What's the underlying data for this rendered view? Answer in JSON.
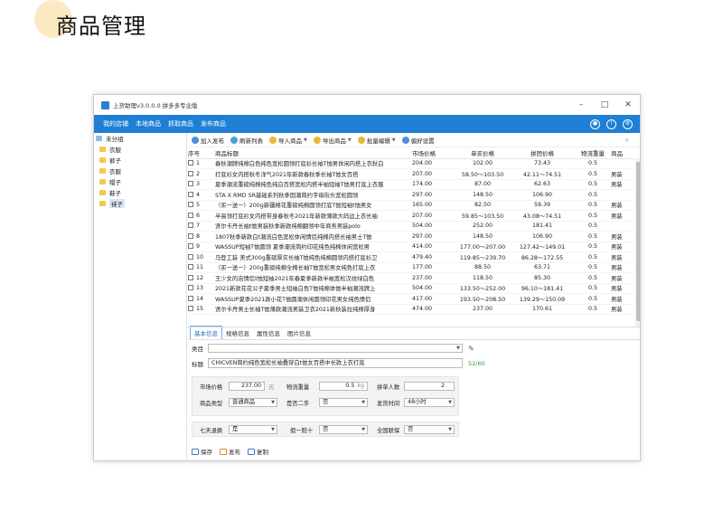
{
  "heading": "商品管理",
  "window": {
    "title": "上货助理v3.0.0.0 拼多多专业版",
    "min": "–",
    "max": "□",
    "close": "✕"
  },
  "menu": [
    "我的店铺",
    "本地商品",
    "抓取商品",
    "发布商品"
  ],
  "sidebar": [
    "未分组",
    "衣服",
    "裤子",
    "衣服",
    "帽子",
    "鞋子",
    "袜子"
  ],
  "toolbar": {
    "add": "加入发布",
    "refresh": "刷新列表",
    "import": "导入商品",
    "export": "导出商品",
    "batch": "批量编辑",
    "settings": "偏好设置"
  },
  "table": {
    "headers": [
      "序号",
      "商品标题",
      "市场价格",
      "单买价格",
      "拼团价格",
      "物流重量",
      "商品"
    ],
    "rows": [
      [
        "1",
        "春秋潮牌纯棉白色纯色宽松圆领打底衫长袖T恤男休闲内搭上衣秋白",
        "204.00",
        "102.00",
        "73.43",
        "0.5",
        ""
      ],
      [
        "2",
        "打底衫女内搭秋冬洋气2021年新款春秋季长袖T恤女百搭",
        "207.00",
        "58.50～103.50",
        "42.11～74.51",
        "0.5",
        "男装"
      ],
      [
        "3",
        "夏季潮流重磅纯棉纯色纯白百搭宽松内搭半袖短袖T恤男打底上衣服",
        "174.00",
        "87.00",
        "62.63",
        "0.5",
        "男装"
      ],
      [
        "4",
        "STA X RMD SR基础系列秋季国潮简约字母街头宽松圆领",
        "297.00",
        "148.50",
        "106.90",
        "0.5",
        ""
      ],
      [
        "5",
        "（买一送一）200g新疆棉花重磅纯棉圆领打底T恤短袖t恤男女",
        "165.00",
        "82.50",
        "59.39",
        "0.5",
        "男装"
      ],
      [
        "6",
        "半高领打底衫女内搭带身春秋冬2021年新款薄款大码边上衣长袖",
        "207.00",
        "59.85～103.50",
        "43.08～74.51",
        "0.5",
        "男装"
      ],
      [
        "7",
        "贤尔卡丹长袖t恤男装秋季新款纯棉翻领中年商务男装polo",
        "504.00",
        "252.00",
        "181.41",
        "0.5",
        ""
      ],
      [
        "8",
        "1807秋季新款白t潮流白色宽松休闲情侣纯棉内搭长袖男士T恤",
        "297.00",
        "148.50",
        "106.90",
        "0.5",
        "男装"
      ],
      [
        "9",
        "WASSUP短袖T恤圆领 夏季潮流简约印花纯色纯棉休闲宽松男",
        "414.00",
        "177.00～207.00",
        "127.42～149.01",
        "0.5",
        "男装"
      ],
      [
        "10",
        "马登工装 美式300g重磅厚实长袖T恤纯色纯棉圆领内搭打底衫卫",
        "479.40",
        "119.85～239.70",
        "86.28～172.55",
        "0.5",
        "男装"
      ],
      [
        "11",
        "（买一送一）200g重磅纯棉全棉长袖T恤宽松男女纯色打底上衣",
        "177.00",
        "88.50",
        "63.71",
        "0.5",
        "男装"
      ],
      [
        "12",
        "王少女的店情侣t恤短袖2021年春夏季新款半袖宽松汉纹绿白色",
        "237.00",
        "118.50",
        "85.30",
        "0.5",
        "男装"
      ],
      [
        "13",
        "2021新款花花公子夏季男士短袖白色T恤纯棉体恤半袖潮流牌上",
        "504.00",
        "133.50～252.00",
        "96.10～181.41",
        "0.5",
        "男装"
      ],
      [
        "14",
        "WASSUP夏季2021款小花T恤圆潮休闲圆领印花男女纯色情侣",
        "417.00",
        "193.50～208.50",
        "139.29～150.09",
        "0.5",
        "男装"
      ],
      [
        "15",
        "贤尔卡丹男士长袖T恤薄款潮流男装卫衣2021新秋装拉纯棉厚身",
        "474.00",
        "237.00",
        "170.61",
        "0.5",
        "男装"
      ]
    ]
  },
  "tabs": [
    "基本信息",
    "规格信息",
    "属性信息",
    "图片信息"
  ],
  "form": {
    "category_label": "类目",
    "title_label": "标题",
    "title_value": "CHICVEN简约纯色宽松长袖叠穿白t恤女百搭中长款上衣打底",
    "title_count": "52/60",
    "market_price_label": "市场价格",
    "market_price_value": "237.00",
    "market_price_unit": "元",
    "weight_label": "物流重量",
    "weight_value": "0.5",
    "weight_unit": "kg",
    "group_label": "拼单人数",
    "group_value": "2",
    "type_label": "商品类型",
    "type_value": "普通商品",
    "second_label": "是否二手",
    "second_value": "否",
    "ship_label": "发货时间",
    "ship_value": "48小时",
    "return_label": "七天退换",
    "return_value": "是",
    "fake_label": "假一赔十",
    "fake_value": "否",
    "insure_label": "全国联保",
    "insure_value": "否"
  },
  "bottom": {
    "save": "保存",
    "publish": "发布",
    "copy": "复制"
  },
  "colors": {
    "accent": "#1f7fd4",
    "count": "#2a9d3a",
    "folder": "#f2c94c"
  }
}
